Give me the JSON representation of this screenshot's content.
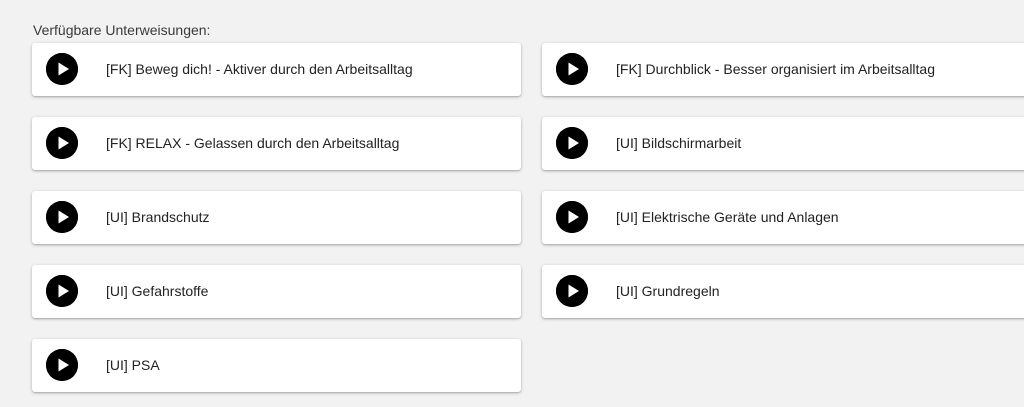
{
  "heading": "Verfügbare Unterweisungen:",
  "items": [
    {
      "label": "[FK] Beweg dich! - Aktiver durch den Arbeitsalltag",
      "icon": "play-icon"
    },
    {
      "label": "[FK] Durchblick - Besser organisiert im Arbeitsalltag",
      "icon": "play-icon"
    },
    {
      "label": "[FK] RELAX - Gelassen durch den Arbeitsalltag",
      "icon": "play-icon"
    },
    {
      "label": "[UI] Bildschirmarbeit",
      "icon": "play-icon"
    },
    {
      "label": "[UI] Brandschutz",
      "icon": "play-icon"
    },
    {
      "label": "[UI] Elektrische Geräte und Anlagen",
      "icon": "play-icon"
    },
    {
      "label": "[UI] Gefahrstoffe",
      "icon": "play-icon"
    },
    {
      "label": "[UI] Grundregeln",
      "icon": "play-icon"
    },
    {
      "label": "[UI] PSA",
      "icon": "play-icon"
    }
  ],
  "colors": {
    "background": "#f2f2f2",
    "card": "#ffffff",
    "icon": "#000000",
    "text": "#222222"
  }
}
